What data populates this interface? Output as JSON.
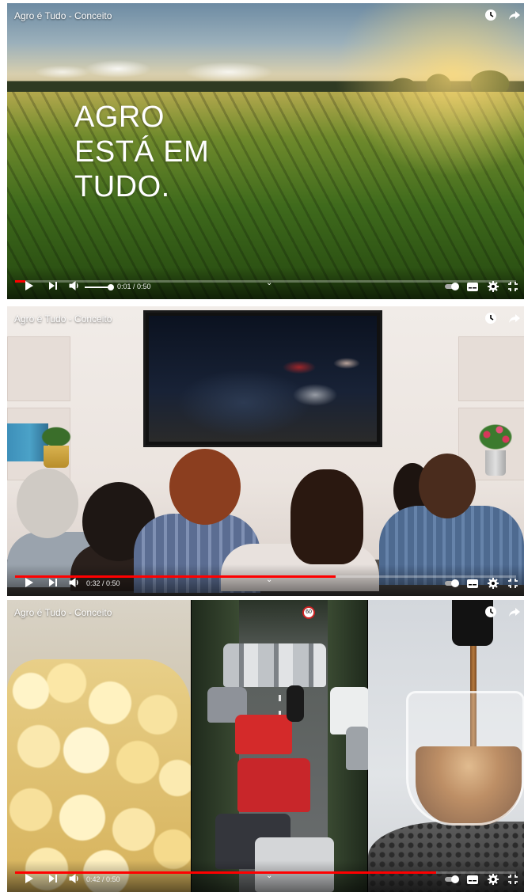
{
  "video": {
    "title": "Agro é Tudo - Conceito"
  },
  "frames": [
    {
      "headline": "AGRO\nESTÁ EM\nTUDO.",
      "time": "0:01 / 0:50",
      "progress": 0.02
    },
    {
      "time": "0:32 / 0:50",
      "progress": 0.64
    },
    {
      "time": "0:42 / 0:50",
      "progress": 0.84
    }
  ],
  "scene": {
    "speed_sign": "60"
  },
  "icons": {
    "watch_later": "clock-icon",
    "share": "share-arrow-icon",
    "play": "play-icon",
    "next": "next-icon",
    "volume": "volume-icon",
    "autoplay": "autoplay-toggle-icon",
    "captions": "captions-icon",
    "settings": "gear-icon",
    "exit_fullscreen": "exit-fullscreen-icon",
    "chevron": "chevron-down-icon"
  },
  "colors": {
    "progress": "#ff0000",
    "text": "#ffffff"
  }
}
